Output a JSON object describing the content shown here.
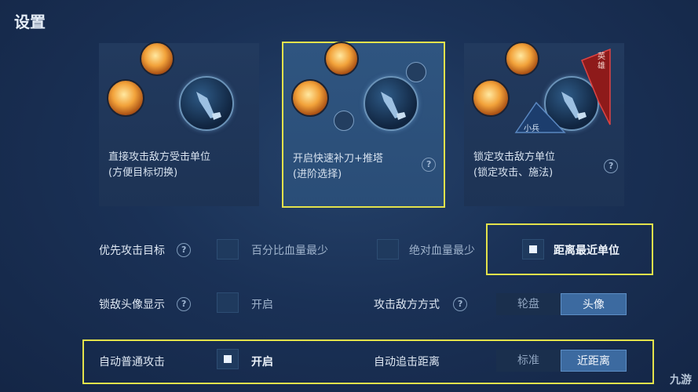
{
  "header": {
    "title": "设置"
  },
  "cards": [
    {
      "line1": "直接攻击敌方受击单位",
      "line2": "(方便目标切换)",
      "selected": false
    },
    {
      "line1": "开启快速补刀+推塔",
      "line2": "(进阶选择)",
      "selected": true
    },
    {
      "line1": "锁定攻击敌方单位",
      "line2": "(锁定攻击、施法)",
      "selected": false,
      "tag_hero": "英雄",
      "tag_minion": "小兵"
    }
  ],
  "settings": {
    "priority": {
      "label": "优先攻击目标",
      "options": [
        "百分比血量最少",
        "绝对血量最少",
        "距离最近单位"
      ],
      "selected": "距离最近单位"
    },
    "lock_avatar": {
      "label": "锁敌头像显示",
      "option": "开启",
      "checked": false
    },
    "attack_mode": {
      "label": "攻击敌方方式",
      "options": [
        "轮盘",
        "头像"
      ],
      "selected": "头像"
    },
    "auto_attack": {
      "label": "自动普通攻击",
      "option": "开启",
      "checked": true
    },
    "auto_chase": {
      "label": "自动追击距离",
      "options": [
        "标准",
        "近距离"
      ],
      "selected": "近距离"
    }
  },
  "help_glyph": "?",
  "watermark": "九游",
  "colors": {
    "highlight": "#e3e24b",
    "accent": "#3c6aa0",
    "background": "#1a3156"
  }
}
